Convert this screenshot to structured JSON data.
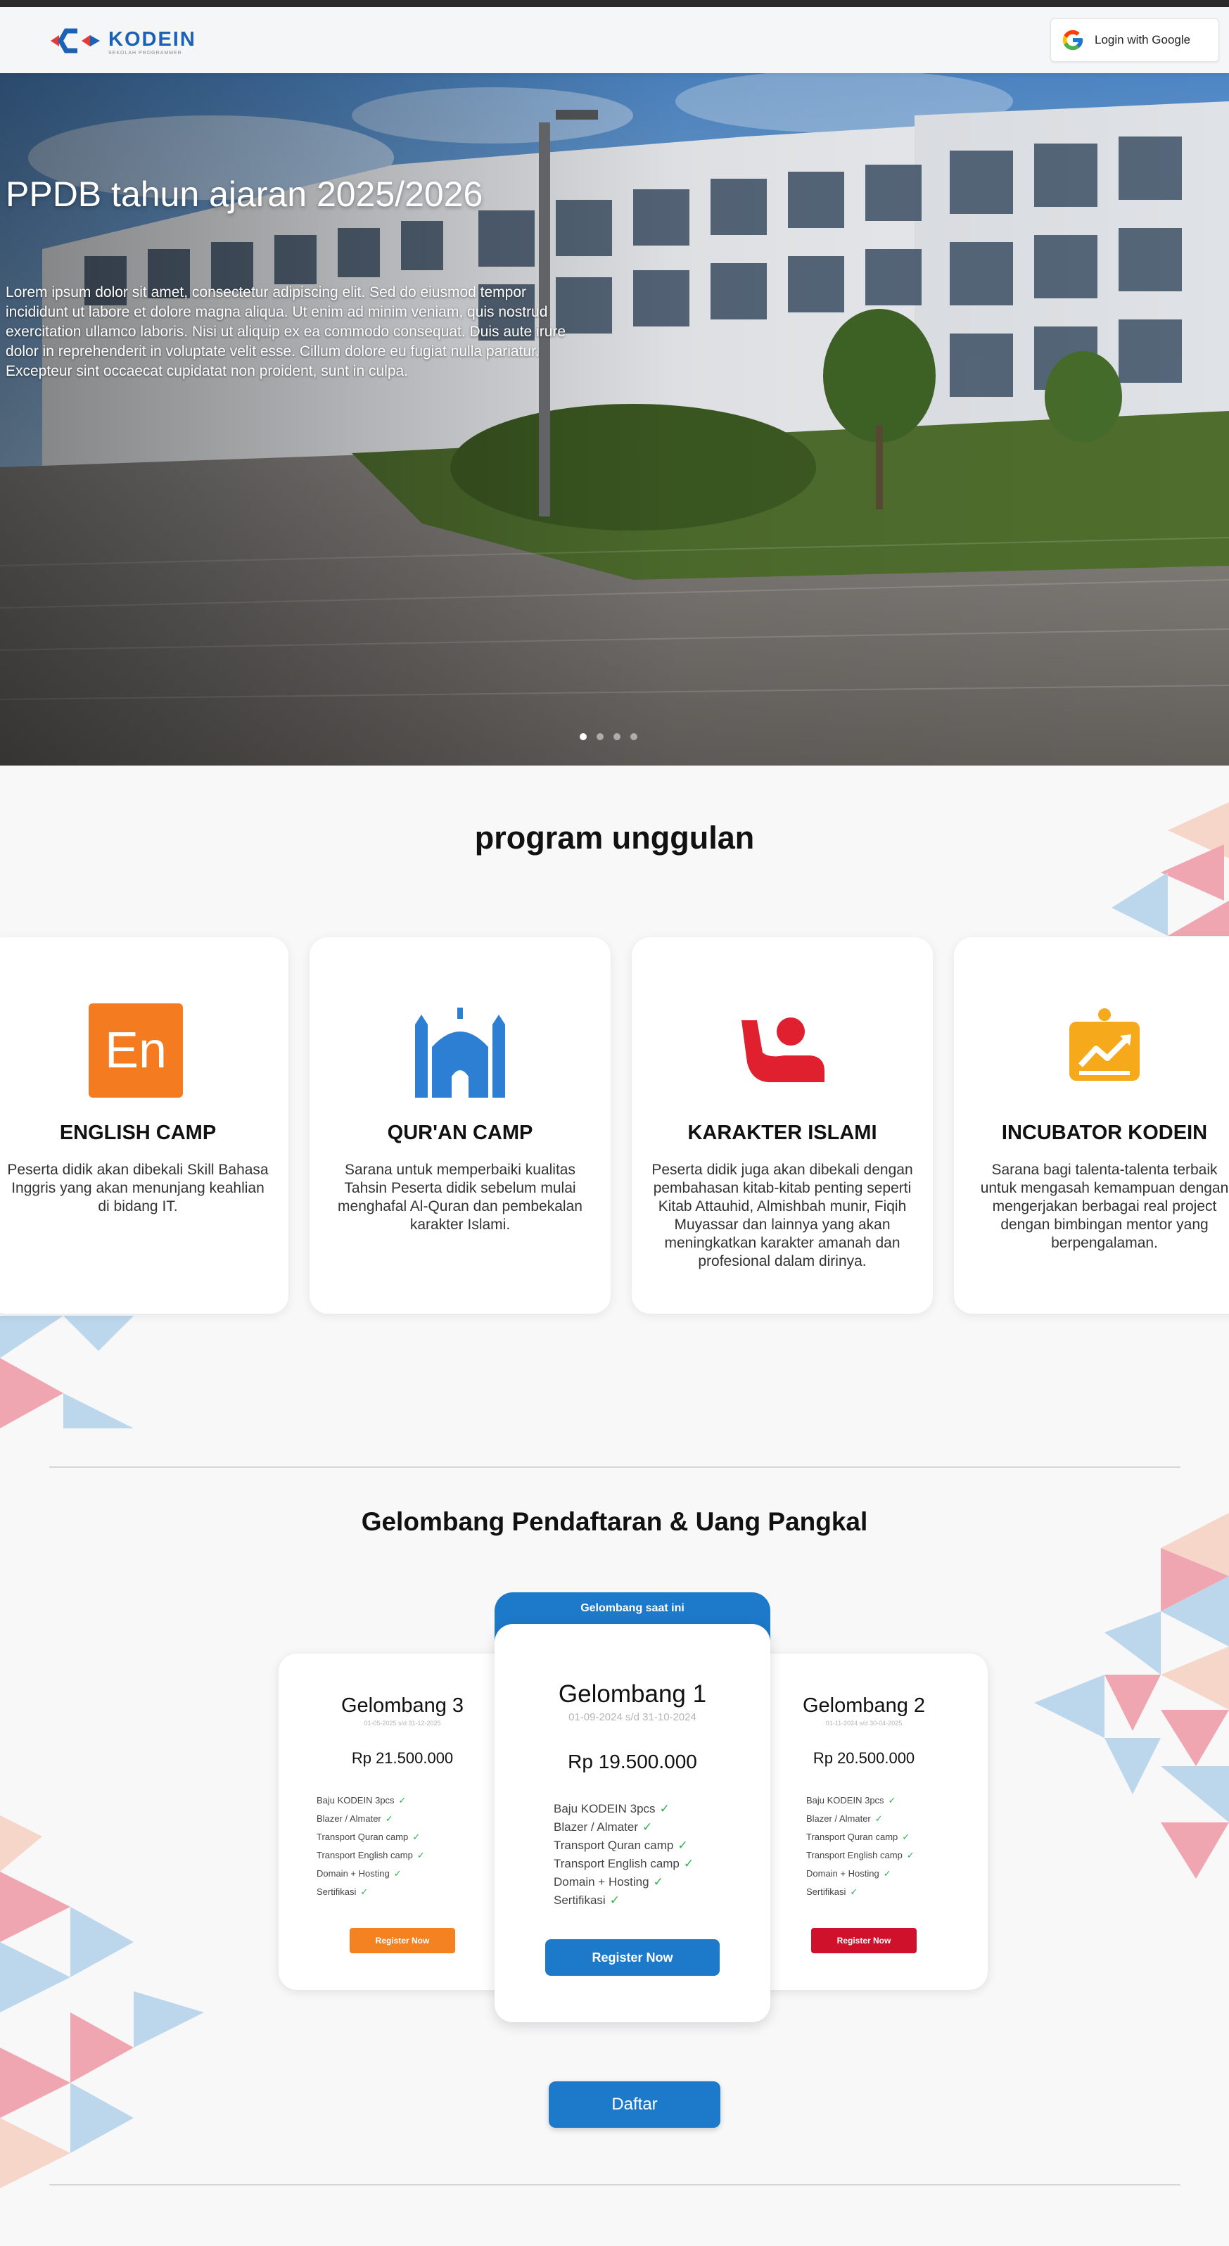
{
  "brand": {
    "name": "KODEIN",
    "tagline": "SEKOLAH PROGRAMMER"
  },
  "nav": {
    "login_label": "Login with Google"
  },
  "hero": {
    "title": "PPDB tahun ajaran 2025/2026",
    "paragraph": "Lorem ipsum dolor sit amet, consectetur adipiscing elit. Sed do eiusmod tempor incididunt ut labore et dolore magna aliqua. Ut enim ad minim veniam, quis nostrud exercitation ullamco laboris. Nisi ut aliquip ex ea commodo consequat. Duis aute irure dolor in reprehenderit in voluptate velit esse. Cillum dolore eu fugiat nulla pariatur. Excepteur sint occaecat cupidatat non proident, sunt in culpa.",
    "slides": 4,
    "active_slide": 1
  },
  "programs": {
    "title": "program unggulan",
    "items": [
      {
        "icon": "english-icon",
        "icon_text": "En",
        "title": "ENGLISH CAMP",
        "desc": "Peserta didik akan dibekali Skill Bahasa Inggris yang akan menunjang keahlian di bidang IT.",
        "color": "#f47b20"
      },
      {
        "icon": "mosque-icon",
        "title": "QUR'AN CAMP",
        "desc": "Sarana untuk memperbaiki kualitas Tahsin Peserta didik sebelum mulai menghafal Al-Quran dan pembekalan karakter Islami.",
        "color": "#2d7fd3"
      },
      {
        "icon": "person-raise-hand-icon",
        "title": "KARAKTER ISLAMI",
        "desc": "Peserta didik juga akan dibekali dengan pembahasan kitab-kitab penting seperti Kitab Attauhid, Almishbah munir, Fiqih Muyassar dan lainnya yang akan meningkatkan karakter amanah dan profesional dalam dirinya.",
        "color": "#e0202f"
      },
      {
        "icon": "presentation-chart-icon",
        "title": "INCUBATOR KODEIN",
        "desc": "Sarana bagi talenta-talenta terbaik untuk mengasah kemampuan dengan mengerjakan berbagai real project dengan bimbingan mentor yang berpengalaman.",
        "color": "#f6a91a"
      }
    ]
  },
  "waves": {
    "title": "Gelombang Pendaftaran & Uang Pangkal",
    "current_badge": "Gelombang saat ini",
    "items": [
      {
        "name": "Gelombang 3",
        "dates": "01-05-2025 s/d 31-12-2025",
        "price": "Rp 21.500.000",
        "button": "Register Now",
        "color": "#f58220",
        "features": [
          "Baju KODEIN 3pcs",
          "Blazer / Almater",
          "Transport Quran camp",
          "Transport English camp",
          "Domain + Hosting",
          "Sertifikasi"
        ]
      },
      {
        "name": "Gelombang 1",
        "dates": "01-09-2024 s/d 31-10-2024",
        "price": "Rp 19.500.000",
        "button": "Register Now",
        "color": "#1d79c9",
        "features": [
          "Baju KODEIN 3pcs",
          "Blazer / Almater",
          "Transport Quran camp",
          "Transport English camp",
          "Domain + Hosting",
          "Sertifikasi"
        ]
      },
      {
        "name": "Gelombang 2",
        "dates": "01-11-2024 s/d 30-04-2025",
        "price": "Rp 20.500.000",
        "button": "Register Now",
        "color": "#d0112b",
        "features": [
          "Baju KODEIN 3pcs",
          "Blazer / Almater",
          "Transport Quran camp",
          "Transport English camp",
          "Domain + Hosting",
          "Sertifikasi"
        ]
      }
    ],
    "cta": "Daftar"
  }
}
